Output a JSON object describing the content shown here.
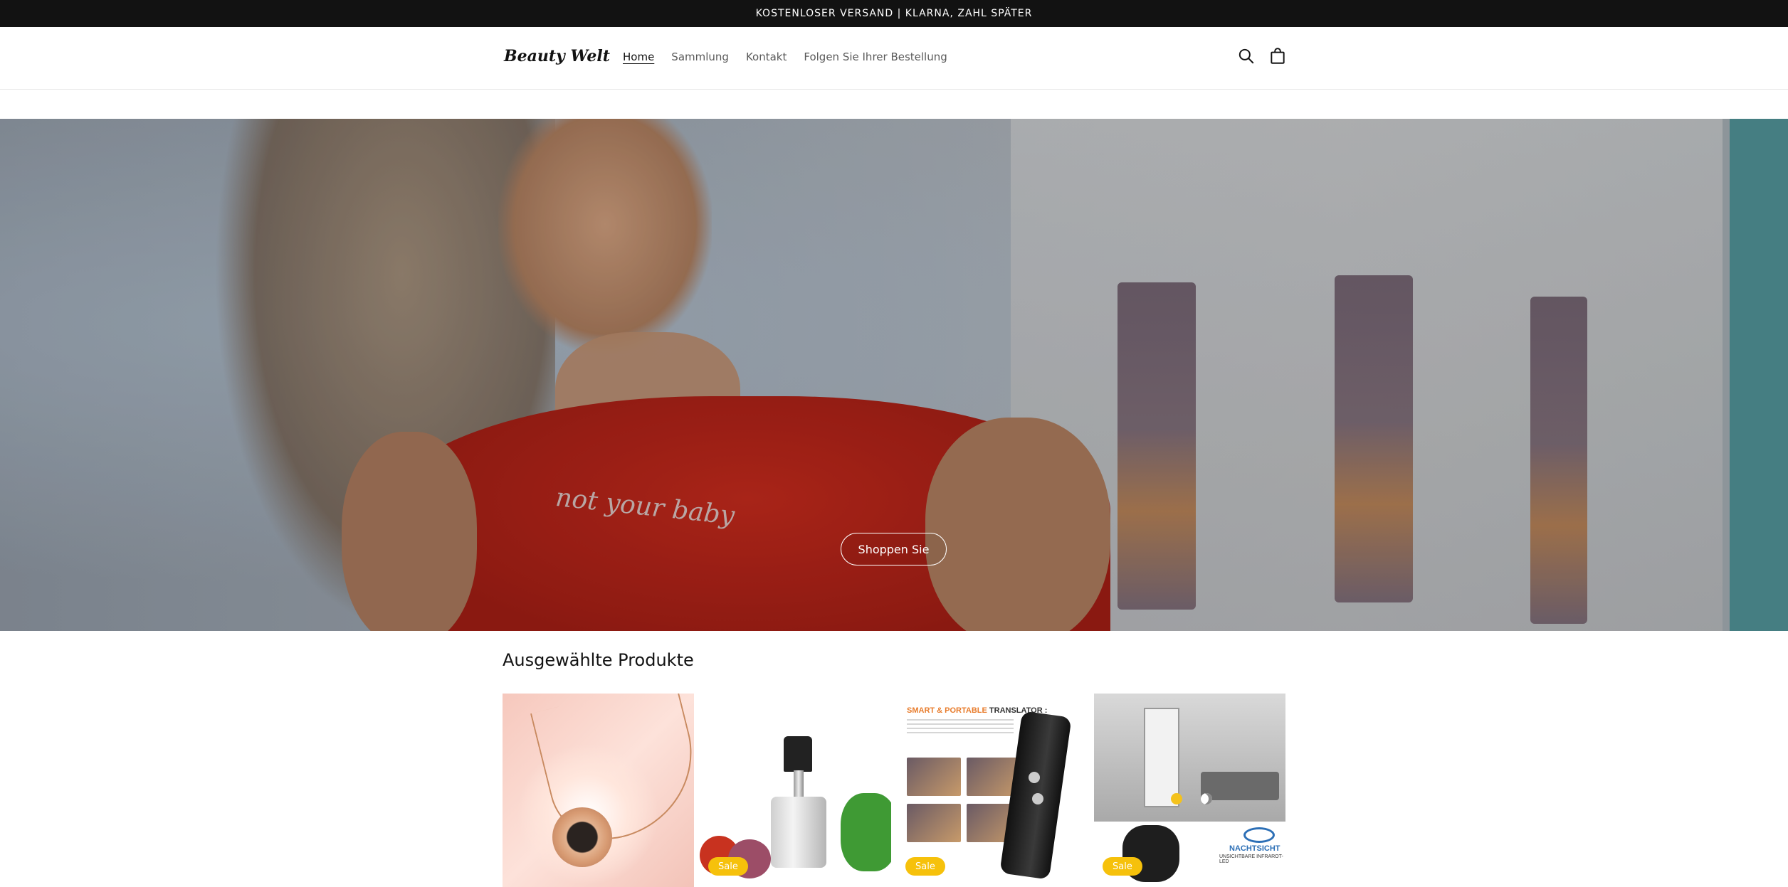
{
  "announcement": {
    "text": "KOSTENLOSER VERSAND | KLARNA, ZAHL SPÄTER"
  },
  "header": {
    "logo": "Beauty Welt",
    "nav": [
      {
        "label": "Home",
        "active": true
      },
      {
        "label": "Sammlung",
        "active": false
      },
      {
        "label": "Kontakt",
        "active": false
      },
      {
        "label": "Folgen Sie Ihrer Bestellung",
        "active": false
      }
    ],
    "icons": [
      "search-icon",
      "cart-icon"
    ]
  },
  "hero": {
    "shirt_print": "not your baby",
    "button_label": "Shoppen Sie"
  },
  "featured": {
    "title": "Ausgewählte Produkte",
    "products": [
      {
        "name": "necklace",
        "badge": ""
      },
      {
        "name": "food-chopper",
        "badge": "Sale"
      },
      {
        "name": "translator",
        "badge": "Sale",
        "image_heading": "SMART & PORTABLE",
        "image_heading_2": "TRANSLATOR :"
      },
      {
        "name": "camera",
        "badge": "Sale",
        "image_label": "NACHTSICHT",
        "image_sublabel": "UNSICHTBARE INFRAROT-LED"
      }
    ]
  },
  "colors": {
    "announcement_bg": "#121212",
    "sale_badge": "#f6c10b",
    "shirt": "#b7241a"
  }
}
